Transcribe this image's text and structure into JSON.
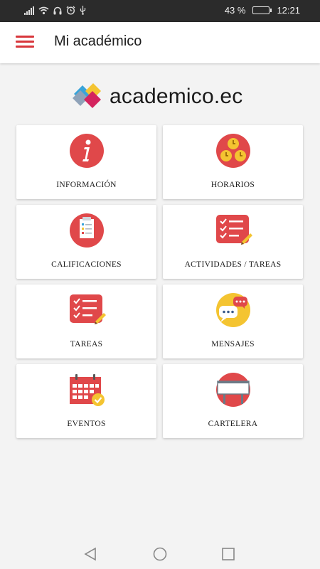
{
  "status_bar": {
    "battery_percent": "43 %",
    "time": "12:21",
    "icons": [
      "signal-icon",
      "wifi-icon",
      "headphones-icon",
      "alarm-icon",
      "usb-icon",
      "battery-icon"
    ]
  },
  "app_bar": {
    "title": "Mi académico",
    "menu_icon": "hamburger-menu-icon"
  },
  "logo": {
    "text": "academico.ec"
  },
  "menu_items": [
    {
      "label": "INFORMACIÓN",
      "icon": "info-icon"
    },
    {
      "label": "HORARIOS",
      "icon": "clock-icon"
    },
    {
      "label": "CALIFICACIONES",
      "icon": "grades-icon"
    },
    {
      "label": "ACTIVIDADES / TAREAS",
      "icon": "checklist-icon"
    },
    {
      "label": "TAREAS",
      "icon": "tasks-icon"
    },
    {
      "label": "MENSAJES",
      "icon": "messages-icon"
    },
    {
      "label": "EVENTOS",
      "icon": "calendar-icon"
    },
    {
      "label": "CARTELERA",
      "icon": "billboard-icon"
    }
  ],
  "nav_bar": {
    "buttons": [
      "back-icon",
      "home-icon",
      "recents-icon"
    ]
  },
  "colors": {
    "accent_red": "#e0484a",
    "yellow": "#f4c431",
    "status_bar_bg": "#2b2b2b"
  }
}
